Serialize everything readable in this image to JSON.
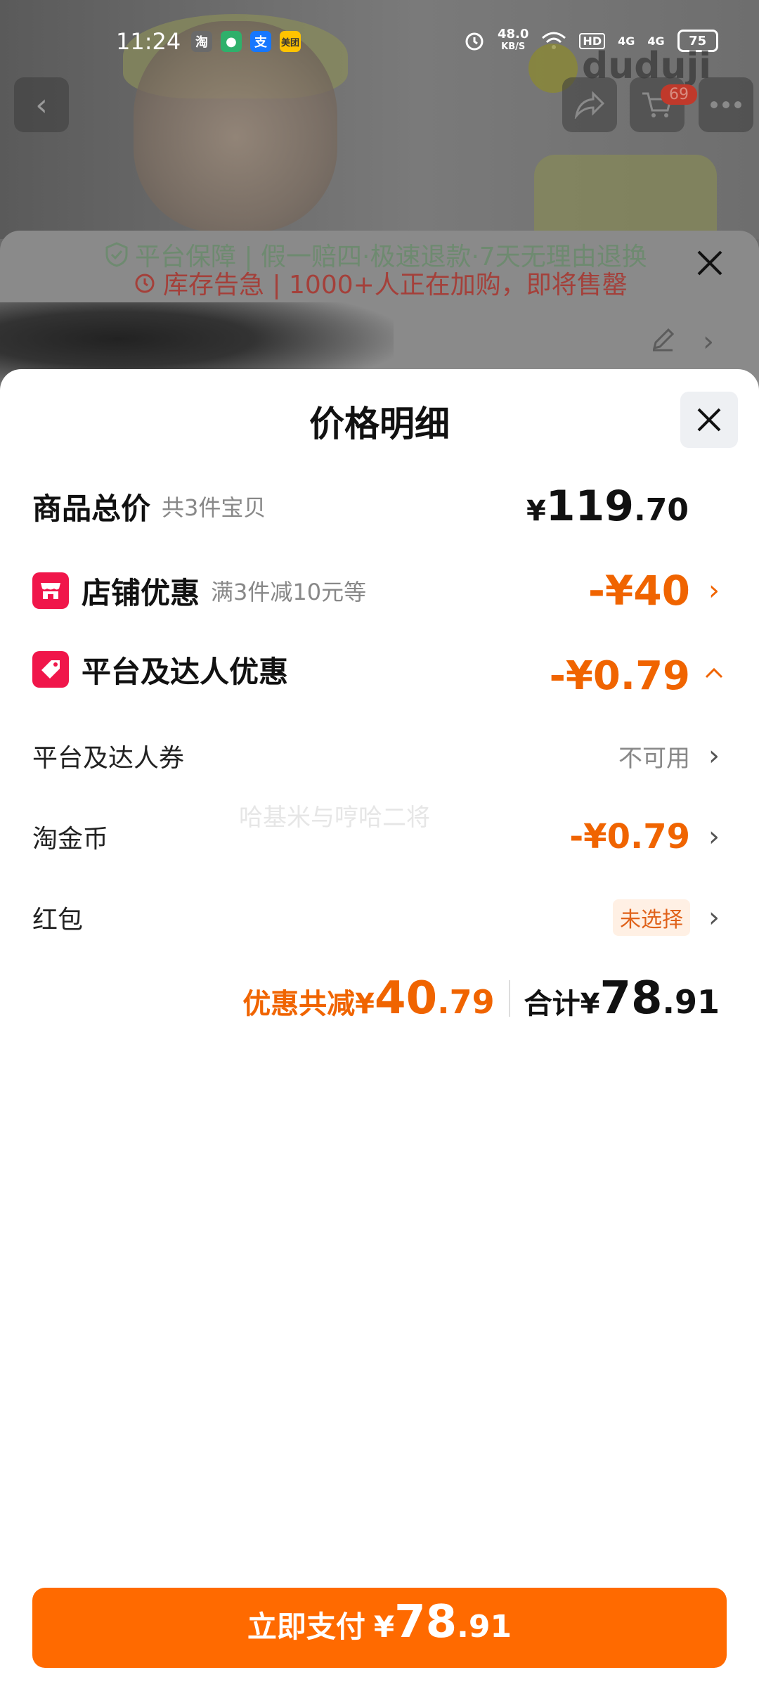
{
  "status_bar": {
    "time": "11:24",
    "apps": [
      {
        "label": "淘",
        "color": "#6a6a6a",
        "icon": "taobao-icon"
      },
      {
        "label": "●",
        "color": "#2fb06b",
        "icon": "chat-app-icon"
      },
      {
        "label": "支",
        "color": "#1677ff",
        "icon": "alipay-icon"
      },
      {
        "label": "美团",
        "color": "#ffc300",
        "icon": "meituan-icon"
      }
    ],
    "net_speed_value": "48.0",
    "net_speed_unit": "KB/S",
    "hd": "HD",
    "signal1": "4G",
    "signal2": "4G",
    "battery": "75"
  },
  "watermark": "duduji",
  "cart_badge": "69",
  "behind_sheet": {
    "guarantee": "平台保障 | 假一赔四·极速退款·7天无理由退换",
    "stock_alert": "库存告急 | 1000+人正在加购，即将售罄"
  },
  "sheet": {
    "title": "价格明细",
    "goods_total": {
      "label": "商品总价",
      "sub": "共3件宝贝",
      "yen": "¥",
      "int": "119",
      "dec": ".70"
    },
    "shop_discount": {
      "label": "店铺优惠",
      "sub": "满3件减10元等",
      "amount": "-¥40"
    },
    "platform_discount": {
      "label": "平台及达人优惠",
      "amount": "-¥0.79"
    },
    "platform_coupon": {
      "label": "平台及达人券",
      "value": "不可用"
    },
    "tao_coins": {
      "label": "淘金币",
      "amount": "-¥0.79"
    },
    "red_packet": {
      "label": "红包",
      "value": "未选择"
    },
    "faint_watermark": "哈基米与哼哈二将",
    "summary": {
      "discount_label": "优惠共减¥",
      "discount_int": "40",
      "discount_dec": ".79",
      "total_label": "合计¥",
      "total_int": "78",
      "total_dec": ".91"
    },
    "pay_button": {
      "label": "立即支付",
      "yen": "¥",
      "int": "78",
      "dec": ".91"
    }
  },
  "colors": {
    "accent": "#ff6a00",
    "discount": "#f06400",
    "shop_icon": "#f0164a"
  }
}
